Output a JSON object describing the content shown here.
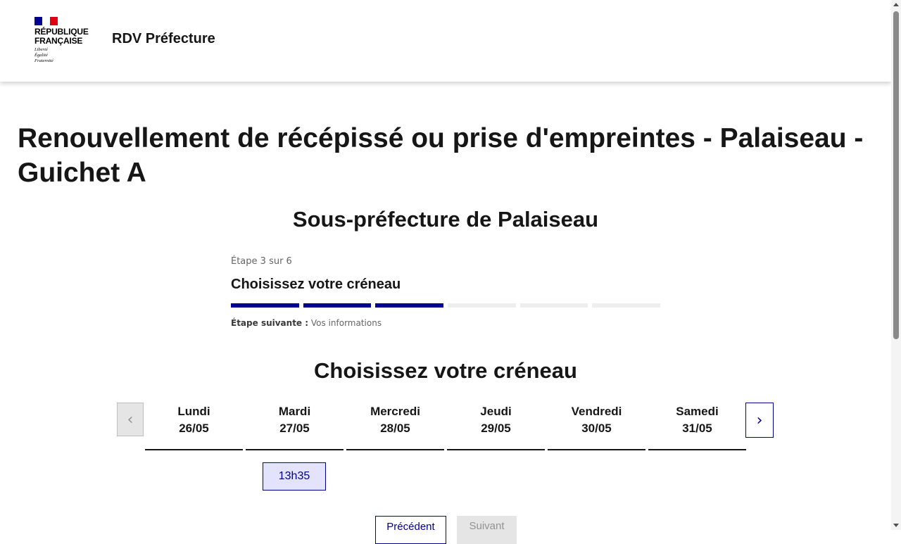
{
  "header": {
    "logo": {
      "name_line1": "RÉPUBLIQUE",
      "name_line2": "FRANÇAISE",
      "motto_line1": "Liberté",
      "motto_line2": "Égalité",
      "motto_line3": "Fraternité",
      "flag_colors": [
        "#000091",
        "#ffffff",
        "#e1000f"
      ]
    },
    "service_title": "RDV Préfecture"
  },
  "main": {
    "page_title": "Renouvellement de récépissé ou prise d'empreintes - Palaiseau - Guichet A",
    "subtitle": "Sous-préfecture de Palaiseau",
    "stepper": {
      "state": "Étape 3 sur 6",
      "title": "Choisissez votre créneau",
      "current_step": 3,
      "total_steps": 6,
      "next_label": "Étape suivante :",
      "next_value": "Vos informations"
    },
    "slot_section_title": "Choisissez votre créneau",
    "calendar": {
      "prev_icon": "chevron-left-icon",
      "next_icon": "chevron-right-icon",
      "days": [
        {
          "name": "Lundi",
          "date": "26/05"
        },
        {
          "name": "Mardi",
          "date": "27/05"
        },
        {
          "name": "Mercredi",
          "date": "28/05"
        },
        {
          "name": "Jeudi",
          "date": "29/05"
        },
        {
          "name": "Vendredi",
          "date": "30/05"
        },
        {
          "name": "Samedi",
          "date": "31/05"
        }
      ],
      "slot": "13h35"
    },
    "buttons": {
      "previous": "Précédent",
      "next": "Suivant"
    }
  },
  "colors": {
    "primary": "#000091",
    "slot_selected_bg": "#e3e3fd",
    "disabled_bg": "#e5e5e5",
    "disabled_text": "#929292",
    "text": "#161616"
  }
}
